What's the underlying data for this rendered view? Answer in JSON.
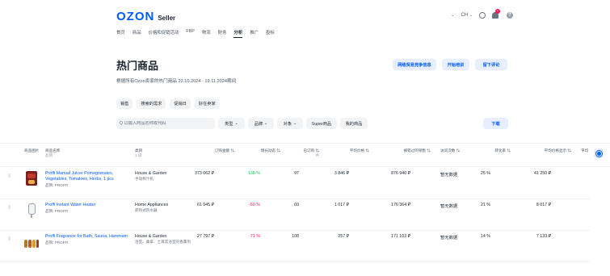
{
  "header": {
    "logo": "OZON",
    "logo_sub": "Seller",
    "nav": [
      "首页",
      "商品",
      "价格和促销活动",
      "FBP",
      "物流",
      "财务",
      "分析",
      "推广",
      "投标"
    ],
    "active_nav": "分析",
    "country": "CH"
  },
  "page": {
    "title": "热门商品",
    "subtitle": "根据所有Ozon卖家的热门商品 22.10.2024 - 19.11.2024期间"
  },
  "actions": {
    "competitive": "网络贸易竞争信息",
    "start": "开始培训",
    "leave_review": "留下评论"
  },
  "tabs": [
    "销售",
    "搜索的需求",
    "促销日",
    "好在卖家"
  ],
  "filters": {
    "search_placeholder": "Q 以输入商品名称或代码",
    "chips": [
      "类型",
      "品牌",
      "对象",
      "Super商品",
      "我的商品"
    ],
    "download": "下载"
  },
  "columns": [
    {
      "label": "商品图片",
      "sub": ""
    },
    {
      "label": "商品名称",
      "sub": "品牌"
    },
    {
      "label": "类目",
      "sub": "1 级"
    },
    {
      "label": "订购金额 ⇅",
      "sub": ""
    },
    {
      "label": "增长动态 ⇅",
      "sub": ""
    },
    {
      "label": "已订购 ⇅",
      "sub": "件"
    },
    {
      "label": "平均价格 ⇅",
      "sub": ""
    },
    {
      "label": "被错过的销售 ⇅",
      "sub": ""
    },
    {
      "label": "访问次数 ⇅",
      "sub": ""
    },
    {
      "label": "转化率 ⇅",
      "sub": ""
    },
    {
      "label": "平均价格显示 ⇅",
      "sub": ""
    },
    {
      "label": "平均",
      "sub": ""
    }
  ],
  "rows": [
    {
      "name": "Proffi Manual Juicer Pomegranates, Vegetables, Tomatoes, Herbs, 1 pcs",
      "brand": "品牌: PROFFI",
      "category": "House & Garden",
      "category_sub": "手动榨汁机",
      "amount": "373 062 ₽",
      "growth": "138 %",
      "growth_sign": "pos",
      "ordered": "97",
      "avg_price": "3 846 ₽",
      "missed": "876 940 ₽",
      "visits": "暂无数据",
      "conversion": "25 %",
      "avg_shown": "41 250 ₽"
    },
    {
      "name": "Proffi Instant Water Heater",
      "brand": "品牌: PROFFI",
      "category": "Home Appliances",
      "category_sub": "即热式热水器",
      "amount": "61 045 ₽",
      "growth": "-60 %",
      "growth_sign": "neg",
      "ordered": "60",
      "avg_price": "1 017 ₽",
      "missed": "176 364 ₽",
      "visits": "暂无数据",
      "conversion": "21 %",
      "avg_shown": "8 017 ₽"
    },
    {
      "name": "Proffi Fragrance for Bath, Sauna, Hammam",
      "brand": "品牌: PROFFI",
      "category": "House & Garden",
      "category_sub": "浴室、桑拿、土耳其浴室的香薰剂",
      "amount": "27 797 ₽",
      "growth": "-71 %",
      "growth_sign": "neg",
      "ordered": "108",
      "avg_price": "257 ₽",
      "missed": "171 103 ₽",
      "visits": "暂无数据",
      "conversion": "14 %",
      "avg_shown": "7 133 ₽"
    }
  ]
}
